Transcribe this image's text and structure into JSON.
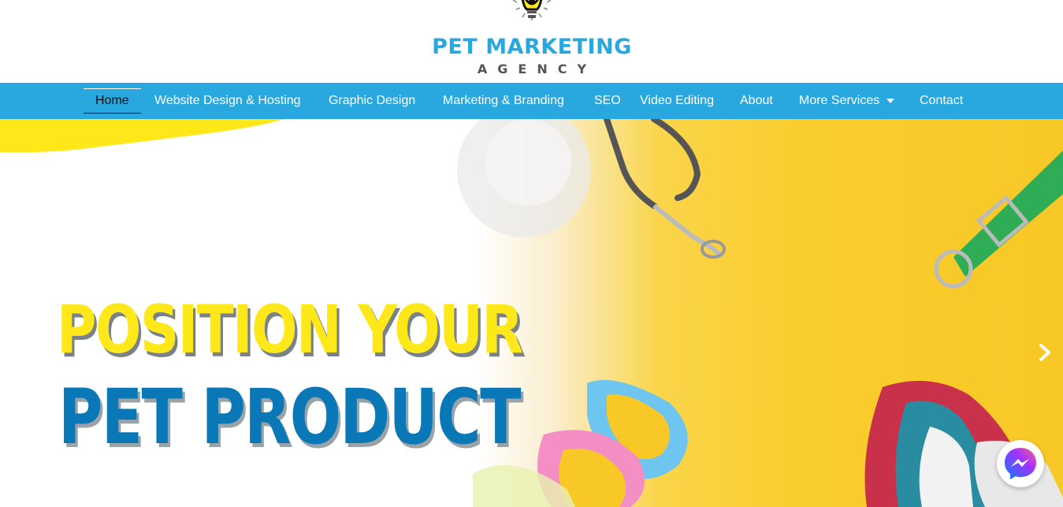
{
  "logo": {
    "title": "PET MARKETING",
    "subtitle": "AGENCY"
  },
  "nav": {
    "items": [
      {
        "label": "Home",
        "active": true
      },
      {
        "label": "Website Design & Hosting"
      },
      {
        "label": "Graphic Design"
      },
      {
        "label": "Marketing & Branding"
      },
      {
        "label": "SEO"
      },
      {
        "label": "Video Editing"
      },
      {
        "label": "About"
      },
      {
        "label": "More Services",
        "has_dropdown": true
      },
      {
        "label": "Contact"
      }
    ]
  },
  "hero": {
    "headline_line1": "POSITION YOUR",
    "headline_line2": "PET PRODUCT"
  },
  "colors": {
    "brand_blue": "#29a8e0",
    "headline_yellow": "#ffe81a",
    "headline_blue": "#0a78b7",
    "hero_yellow": "#f8c826"
  },
  "icons": {
    "slider_next": "chevron-right-icon",
    "chat": "messenger-icon",
    "dropdown": "caret-down-icon"
  }
}
